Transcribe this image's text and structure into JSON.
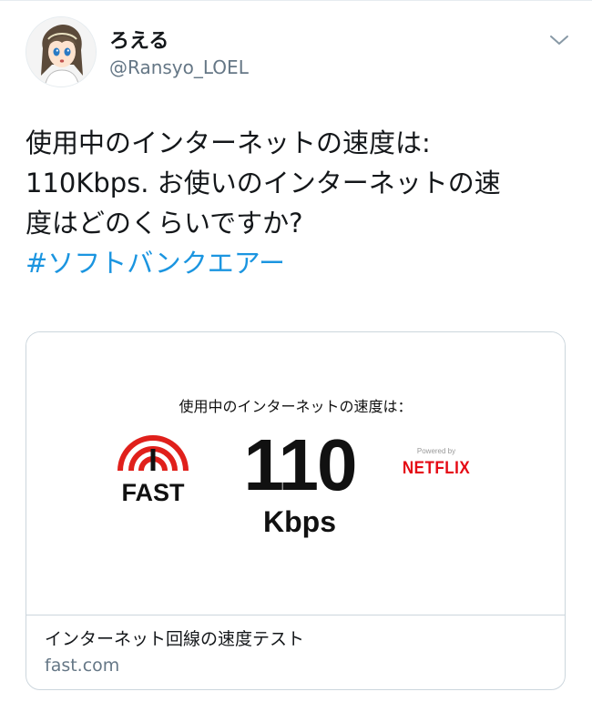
{
  "author": {
    "display_name": "ろえる",
    "handle": "@Ransyo_LOEL"
  },
  "tweet": {
    "lines": [
      "使用中のインターネットの速度は:",
      "110Kbps. お使いのインターネットの速",
      "度はどのくらいですか?"
    ],
    "hashtag": "#ソフトバンクエアー"
  },
  "card": {
    "image": {
      "speed_label": "使用中のインターネットの速度は：",
      "logo_text": "FAST",
      "speed_value": "110",
      "speed_unit": "Kbps",
      "powered_by": "Powered by",
      "brand": "NETFLIX"
    },
    "title": "インターネット回線の速度テスト",
    "domain": "fast.com"
  },
  "icons": {
    "more": "chevron-down-icon",
    "fast_logo": "fast-gauge-icon",
    "avatar": "avatar-image"
  },
  "colors": {
    "hashtag": "#1b95e0",
    "secondary_text": "#657786",
    "fast_red": "#e0201b",
    "netflix_red": "#e50914",
    "border": "#ccd6dd"
  }
}
